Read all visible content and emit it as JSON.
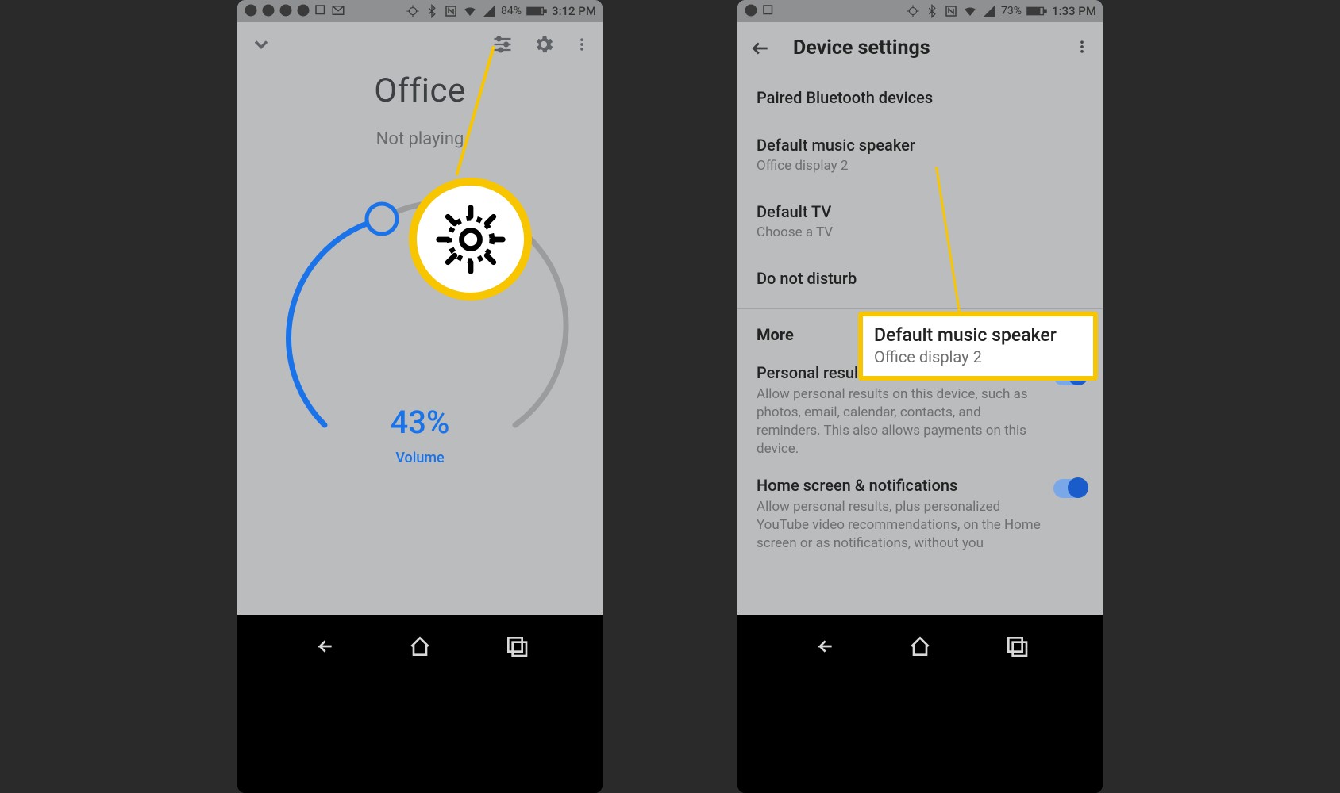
{
  "screen1": {
    "statusbar": {
      "battery": "84%",
      "time": "3:12 PM"
    },
    "device_name": "Office",
    "now_playing": "Not playing",
    "volume_pct": "43%",
    "volume_label": "Volume"
  },
  "screen2": {
    "statusbar": {
      "battery": "73%",
      "time": "1:33 PM"
    },
    "title": "Device settings",
    "items": {
      "bt": {
        "title": "Paired Bluetooth devices"
      },
      "speaker": {
        "title": "Default music speaker",
        "sub": "Office display 2"
      },
      "tv": {
        "title": "Default TV",
        "sub": "Choose a TV"
      },
      "dnd": {
        "title": "Do not disturb"
      }
    },
    "section_more": "More",
    "more": {
      "personal": {
        "title": "Personal results",
        "desc": "Allow personal results on this device, such as photos, email, calendar, contacts, and reminders. This also allows payments on this device."
      },
      "home": {
        "title": "Home screen & notifications",
        "desc": "Allow personal results, plus personalized YouTube video recommendations, on the Home screen or as notifications, without you"
      }
    },
    "callout": {
      "title": "Default music speaker",
      "sub": "Office display 2"
    }
  }
}
